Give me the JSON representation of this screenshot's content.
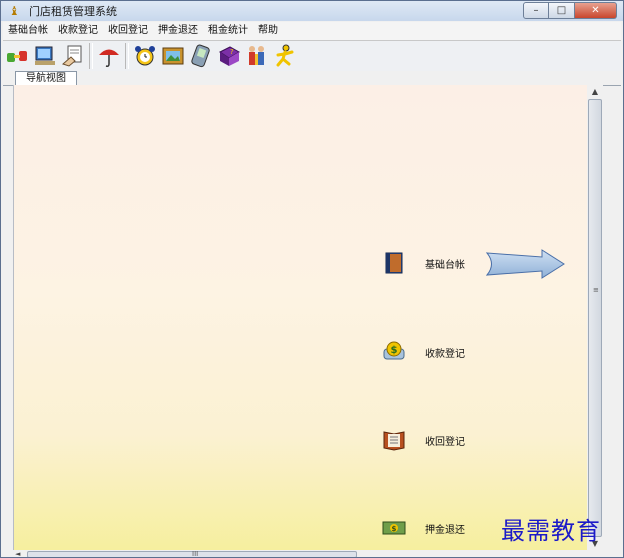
{
  "window": {
    "title": "门店租赁管理系统",
    "controls": {
      "minimize": "–",
      "maximize": "□",
      "close": "✕"
    }
  },
  "menu": [
    "基础台帐",
    "收款登记",
    "收回登记",
    "押金退还",
    "租金统计",
    "帮助"
  ],
  "toolbar": {
    "groups": [
      [
        "connect-icon",
        "monitor-icon",
        "document-hand-icon"
      ],
      [
        "umbrella-icon"
      ],
      [
        "alarm-clock-icon",
        "picture-icon",
        "pda-icon",
        "help-book-icon",
        "users-icon",
        "runner-icon"
      ]
    ]
  },
  "tabs": [
    {
      "label": "导航视图",
      "active": true
    }
  ],
  "nav": {
    "items": [
      {
        "label": "基础台帐",
        "icon": "ledger-book-icon"
      },
      {
        "label": "收款登记",
        "icon": "money-bag-icon"
      },
      {
        "label": "收回登记",
        "icon": "return-book-icon"
      },
      {
        "label": "押金退还",
        "icon": "cash-bill-icon"
      }
    ],
    "arrow_icon": "right-arrow-icon"
  },
  "scroll": {
    "vertical_grip": "≡",
    "horizontal_grip": "III",
    "up": "▲",
    "down": "▼",
    "left": "◄"
  },
  "watermark": "最需教育",
  "colors": {
    "content_top": "#fcefe6",
    "content_bottom": "#f6ef9e",
    "watermark": "#1c1ac8"
  }
}
